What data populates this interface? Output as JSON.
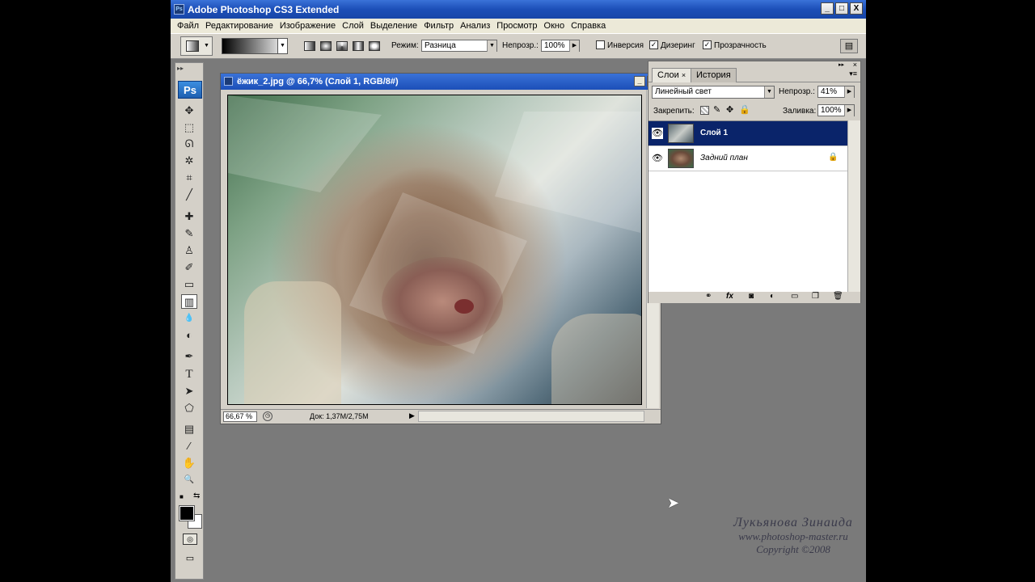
{
  "window": {
    "title": "Adobe Photoshop CS3 Extended",
    "ps_icon": "Ps",
    "minimize": "_",
    "maximize": "□",
    "close": "X"
  },
  "menu": [
    "Файл",
    "Редактирование",
    "Изображение",
    "Слой",
    "Выделение",
    "Фильтр",
    "Анализ",
    "Просмотр",
    "Окно",
    "Справка"
  ],
  "options": {
    "mode_label": "Режим:",
    "mode_value": "Разница",
    "opacity_label": "Непрозр.:",
    "opacity_value": "100%",
    "invert_label": "Инверсия",
    "dither_label": "Дизеринг",
    "transparency_label": "Прозрачность",
    "invert_checked": false,
    "dither_checked": true,
    "transparency_checked": true
  },
  "toolbox": {
    "logo": "Ps",
    "tools": [
      {
        "name": "move-tool",
        "glyph": "✥"
      },
      {
        "name": "marquee-tool",
        "glyph": "⬚"
      },
      {
        "name": "lasso-tool",
        "glyph": "ᘏ"
      },
      {
        "name": "magic-wand-tool",
        "glyph": "✲"
      },
      {
        "name": "crop-tool",
        "glyph": "⌗"
      },
      {
        "name": "eyedropper-slice-tool",
        "glyph": "╱"
      },
      {
        "name": "healing-brush-tool",
        "glyph": "✚"
      },
      {
        "name": "brush-tool",
        "glyph": "✎"
      },
      {
        "name": "clone-stamp-tool",
        "glyph": "♙"
      },
      {
        "name": "history-brush-tool",
        "glyph": "✐"
      },
      {
        "name": "eraser-tool",
        "glyph": "▭"
      },
      {
        "name": "gradient-tool",
        "glyph": "▥"
      },
      {
        "name": "blur-tool",
        "glyph": "💧"
      },
      {
        "name": "dodge-tool",
        "glyph": "◐"
      },
      {
        "name": "pen-tool",
        "glyph": "✒"
      },
      {
        "name": "type-tool",
        "glyph": "T"
      },
      {
        "name": "path-selection-tool",
        "glyph": "➤"
      },
      {
        "name": "shape-tool",
        "glyph": "⬠"
      },
      {
        "name": "notes-tool",
        "glyph": "▤"
      },
      {
        "name": "eyedropper-tool",
        "glyph": "⁄"
      },
      {
        "name": "hand-tool",
        "glyph": "✋"
      },
      {
        "name": "zoom-tool",
        "glyph": "🔍"
      }
    ]
  },
  "document": {
    "title": "ёжик_2.jpg @ 66,7% (Слой 1, RGB/8#)",
    "zoom": "66,67 %",
    "doc_info": "Док: 1,37M/2,75M"
  },
  "layers_panel": {
    "tabs": [
      "Слои",
      "История"
    ],
    "active_tab": "Слои",
    "blend_mode": "Линейный свет",
    "opacity_label": "Непрозр.:",
    "opacity_value": "41%",
    "lock_label": "Закрепить:",
    "fill_label": "Заливка:",
    "fill_value": "100%",
    "layers": [
      {
        "name": "Слой 1",
        "selected": true,
        "locked": false
      },
      {
        "name": "Задний план",
        "selected": false,
        "locked": true
      }
    ],
    "bottom_buttons": [
      "link-icon",
      "fx-icon",
      "mask-icon",
      "adjustment-icon",
      "group-icon",
      "new-layer-icon",
      "trash-icon"
    ]
  },
  "watermark": {
    "name": "Лукьянова Зинаида",
    "url": "www.photoshop-master.ru",
    "copyright": "Copyright ©2008"
  }
}
